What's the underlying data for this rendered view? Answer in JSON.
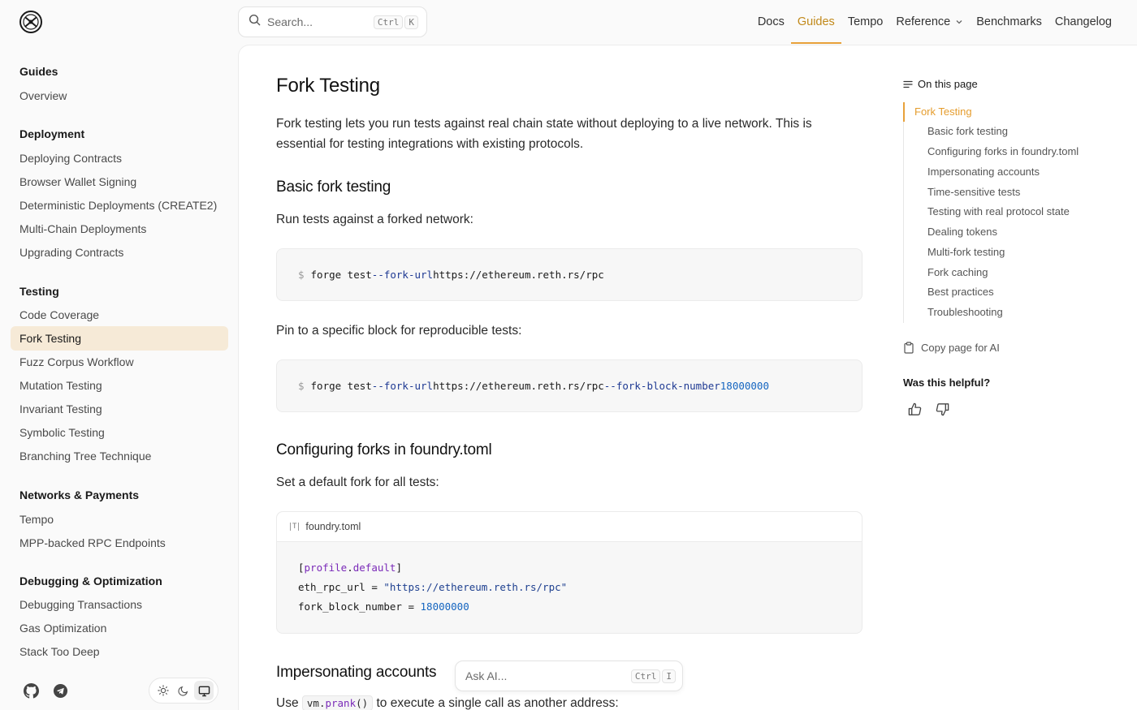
{
  "header": {
    "search_placeholder": "Search...",
    "search_shortcut": [
      "Ctrl",
      "K"
    ],
    "nav": [
      {
        "label": "Docs",
        "active": false
      },
      {
        "label": "Guides",
        "active": true
      },
      {
        "label": "Tempo",
        "active": false
      },
      {
        "label": "Reference",
        "active": false,
        "dropdown": true
      },
      {
        "label": "Benchmarks",
        "active": false
      },
      {
        "label": "Changelog",
        "active": false
      }
    ],
    "accent_color": "#e8a13a"
  },
  "sidebar": {
    "groups": [
      {
        "title": "Guides",
        "items": [
          "Overview"
        ]
      },
      {
        "title": "Deployment",
        "items": [
          "Deploying Contracts",
          "Browser Wallet Signing",
          "Deterministic Deployments (CREATE2)",
          "Multi-Chain Deployments",
          "Upgrading Contracts"
        ]
      },
      {
        "title": "Testing",
        "items": [
          "Code Coverage",
          "Fork Testing",
          "Fuzz Corpus Workflow",
          "Mutation Testing",
          "Invariant Testing",
          "Symbolic Testing",
          "Branching Tree Technique"
        ]
      },
      {
        "title": "Networks & Payments",
        "items": [
          "Tempo",
          "MPP-backed RPC Endpoints"
        ]
      },
      {
        "title": "Debugging & Optimization",
        "items": [
          "Debugging Transactions",
          "Gas Optimization",
          "Stack Too Deep"
        ]
      }
    ],
    "active_item": "Fork Testing",
    "footer_icons": [
      "github-icon",
      "telegram-icon"
    ],
    "theme_options": [
      "sun-icon",
      "moon-icon",
      "monitor-icon"
    ],
    "theme_selected": "monitor-icon"
  },
  "main": {
    "title": "Fork Testing",
    "intro": "Fork testing lets you run tests against real chain state without deploying to a live network. This is essential for testing integrations with existing protocols.",
    "s1_title": "Basic fork testing",
    "s1_text": "Run tests against a forked network:",
    "code1": {
      "prompt": "$",
      "cmd": "forge test",
      "flag1": "--fork-url",
      "url": "https://ethereum.reth.rs/rpc"
    },
    "s1_text2": "Pin to a specific block for reproducible tests:",
    "code2": {
      "prompt": "$",
      "cmd": "forge test",
      "flag1": "--fork-url",
      "url": "https://ethereum.reth.rs/rpc",
      "flag2": "--fork-block-number",
      "block": "18000000"
    },
    "s2_title": "Configuring forks in foundry.toml",
    "s2_text": "Set a default fork for all tests:",
    "code3": {
      "filename": "foundry.toml",
      "section_open": "[",
      "section_name": "profile",
      "section_dot": ".",
      "section_key": "default",
      "section_close": "]",
      "line2_key": "eth_rpc_url",
      "line2_eq": " = ",
      "line2_val": "\"https://ethereum.reth.rs/rpc\"",
      "line3_key": "fork_block_number",
      "line3_eq": " = ",
      "line3_val": "18000000"
    },
    "s3_title": "Impersonating accounts",
    "s3_text_pre": "Use",
    "s3_code_obj": "vm",
    "s3_code_dot": ".",
    "s3_code_fn": "prank",
    "s3_code_paren": "()",
    "s3_text_post": "to execute a single call as another address:",
    "ask_ai_placeholder": "Ask AI...",
    "ask_ai_shortcut": [
      "Ctrl",
      "I"
    ]
  },
  "toc": {
    "heading": "On this page",
    "items": [
      "Fork Testing",
      "Basic fork testing",
      "Configuring forks in foundry.toml",
      "Impersonating accounts",
      "Time-sensitive tests",
      "Testing with real protocol state",
      "Dealing tokens",
      "Multi-fork testing",
      "Fork caching",
      "Best practices",
      "Troubleshooting"
    ],
    "active": "Fork Testing",
    "copy_label": "Copy page for AI",
    "helpful_label": "Was this helpful?"
  }
}
